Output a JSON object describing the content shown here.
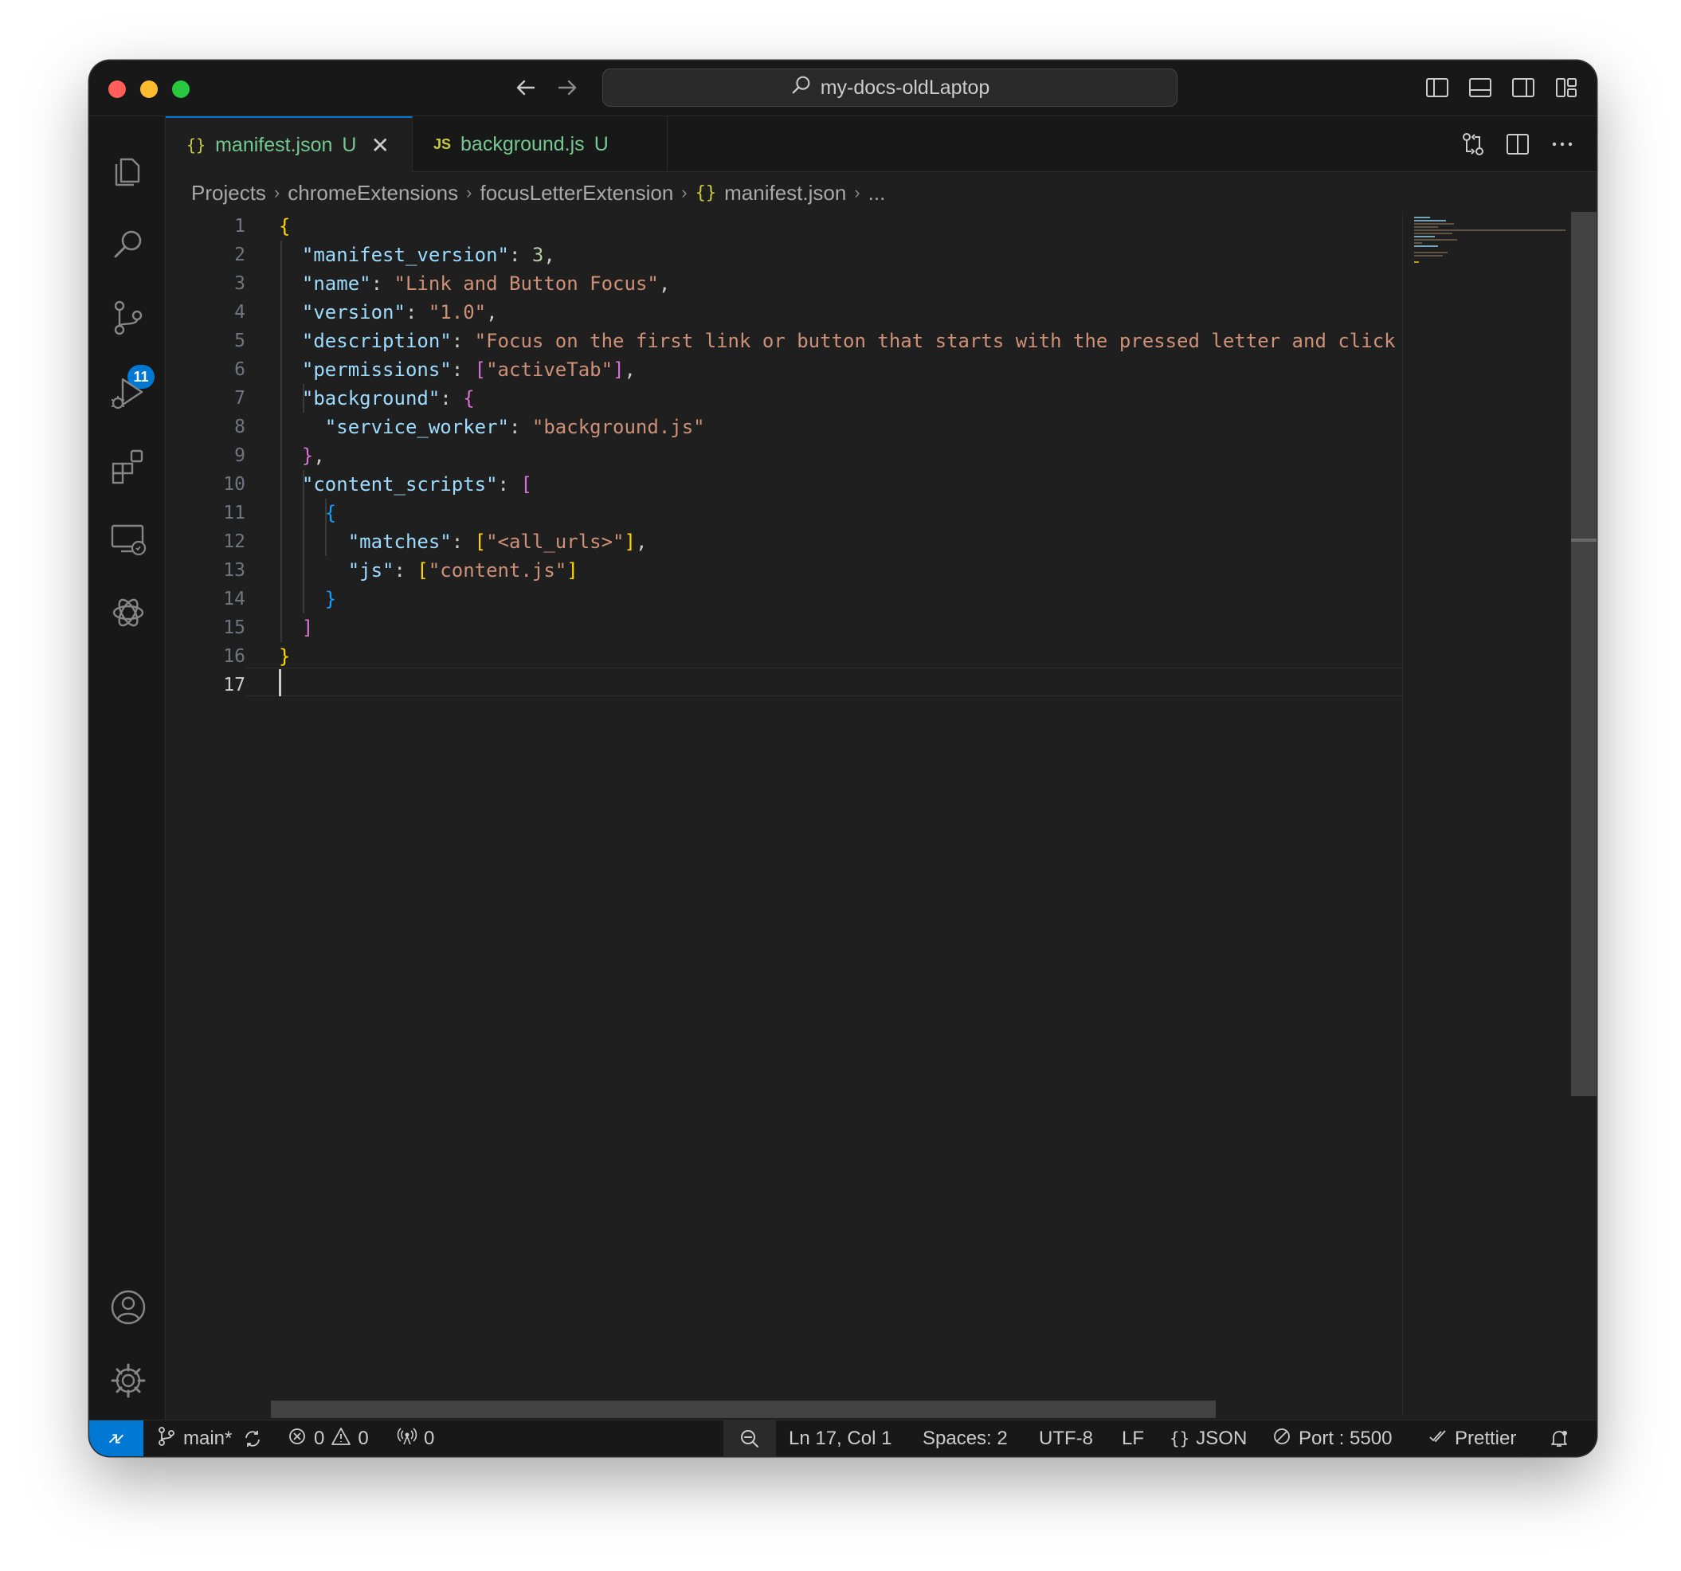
{
  "window": {
    "search_title": "my-docs-oldLaptop"
  },
  "activity": {
    "scm_badge": "11"
  },
  "tabs": [
    {
      "icon": "{}",
      "label": "manifest.json",
      "status": "U"
    },
    {
      "icon": "JS",
      "label": "background.js",
      "status": "U"
    }
  ],
  "breadcrumb": {
    "items": [
      "Projects",
      "chromeExtensions",
      "focusLetterExtension"
    ],
    "file_icon": "{}",
    "file": "manifest.json",
    "more": "..."
  },
  "editor": {
    "line_numbers": [
      "1",
      "2",
      "3",
      "4",
      "5",
      "6",
      "7",
      "8",
      "9",
      "10",
      "11",
      "12",
      "13",
      "14",
      "15",
      "16",
      "17"
    ],
    "code": {
      "manifest_version_key": "\"manifest_version\"",
      "manifest_version_val": "3",
      "name_key": "\"name\"",
      "name_val": "\"Link and Button Focus\"",
      "version_key": "\"version\"",
      "version_val": "\"1.0\"",
      "description_key": "\"description\"",
      "description_val": "\"Focus on the first link or button that starts with the pressed letter and click",
      "permissions_key": "\"permissions\"",
      "permissions_val": "\"activeTab\"",
      "background_key": "\"background\"",
      "service_worker_key": "\"service_worker\"",
      "service_worker_val": "\"background.js\"",
      "content_scripts_key": "\"content_scripts\"",
      "matches_key": "\"matches\"",
      "matches_val": "\"<all_urls>\"",
      "js_key": "\"js\"",
      "js_val": "\"content.js\""
    }
  },
  "status": {
    "branch": "main*",
    "errors": "0",
    "warnings": "0",
    "ports": "0",
    "position": "Ln 17, Col 1",
    "spaces": "Spaces: 2",
    "encoding": "UTF-8",
    "eol": "LF",
    "language_icon": "{}",
    "language": "JSON",
    "port": "Port : 5500",
    "formatter": "Prettier"
  },
  "colors": {
    "accent": "#0078d4",
    "tab_untracked": "#73c991",
    "json_key": "#9cdcfe",
    "json_string": "#ce9178",
    "json_number": "#b5cea8"
  }
}
